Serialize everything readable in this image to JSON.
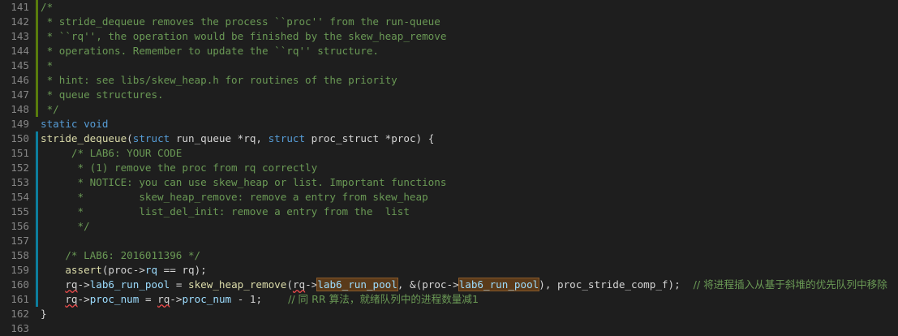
{
  "editor": {
    "lines": [
      {
        "num": "141",
        "bar": "green",
        "tokens": [
          {
            "t": "/*",
            "c": "comment"
          }
        ]
      },
      {
        "num": "142",
        "bar": "green",
        "tokens": [
          {
            "t": " * stride_dequeue removes the process ``proc'' from the run-queue",
            "c": "comment"
          }
        ]
      },
      {
        "num": "143",
        "bar": "green",
        "tokens": [
          {
            "t": " * ``rq'', the operation would be finished by the skew_heap_remove",
            "c": "comment"
          }
        ]
      },
      {
        "num": "144",
        "bar": "green",
        "tokens": [
          {
            "t": " * operations. Remember to update the ``rq'' structure.",
            "c": "comment"
          }
        ]
      },
      {
        "num": "145",
        "bar": "green",
        "tokens": [
          {
            "t": " *",
            "c": "comment"
          }
        ]
      },
      {
        "num": "146",
        "bar": "green",
        "tokens": [
          {
            "t": " * hint: see libs/skew_heap.h for routines of the priority",
            "c": "comment"
          }
        ]
      },
      {
        "num": "147",
        "bar": "green",
        "tokens": [
          {
            "t": " * queue structures.",
            "c": "comment"
          }
        ]
      },
      {
        "num": "148",
        "bar": "green",
        "tokens": [
          {
            "t": " */",
            "c": "comment"
          }
        ]
      },
      {
        "num": "149",
        "bar": "",
        "tokens": [
          {
            "t": "static void",
            "c": "keyword"
          }
        ]
      },
      {
        "num": "150",
        "bar": "blue",
        "tokens": [
          {
            "t": "stride_dequeue",
            "c": "fn"
          },
          {
            "t": "(",
            "c": "plain"
          },
          {
            "t": "struct",
            "c": "keyword"
          },
          {
            "t": " run_queue *rq, ",
            "c": "plain"
          },
          {
            "t": "struct",
            "c": "keyword"
          },
          {
            "t": " proc_struct *proc) {",
            "c": "plain"
          }
        ]
      },
      {
        "num": "151",
        "bar": "blue",
        "tokens": [
          {
            "t": "     /* LAB6: YOUR CODE",
            "c": "comment"
          }
        ]
      },
      {
        "num": "152",
        "bar": "blue",
        "tokens": [
          {
            "t": "      * (1) remove the proc from rq correctly",
            "c": "comment"
          }
        ]
      },
      {
        "num": "153",
        "bar": "blue",
        "tokens": [
          {
            "t": "      * NOTICE: you can use skew_heap or list. Important functions",
            "c": "comment"
          }
        ]
      },
      {
        "num": "154",
        "bar": "blue",
        "tokens": [
          {
            "t": "      *         skew_heap_remove: remove a entry from skew_heap",
            "c": "comment"
          }
        ]
      },
      {
        "num": "155",
        "bar": "blue",
        "tokens": [
          {
            "t": "      *         list_del_init: remove a entry from the  list",
            "c": "comment"
          }
        ]
      },
      {
        "num": "156",
        "bar": "blue",
        "tokens": [
          {
            "t": "      */",
            "c": "comment"
          }
        ]
      },
      {
        "num": "157",
        "bar": "blue",
        "tokens": []
      },
      {
        "num": "158",
        "bar": "blue",
        "tokens": [
          {
            "t": "    /* LAB6: 2016011396 */",
            "c": "comment"
          }
        ]
      },
      {
        "num": "159",
        "bar": "blue",
        "tokens": [
          {
            "t": "    ",
            "c": "plain"
          },
          {
            "t": "assert",
            "c": "fn"
          },
          {
            "t": "(proc->",
            "c": "plain"
          },
          {
            "t": "rq",
            "c": "var"
          },
          {
            "t": " == rq);",
            "c": "plain"
          }
        ]
      },
      {
        "num": "160",
        "bar": "blue",
        "tokens": [
          {
            "t": "    ",
            "c": "plain"
          },
          {
            "t": "rq",
            "c": "plain",
            "sq": true
          },
          {
            "t": "->",
            "c": "plain"
          },
          {
            "t": "lab6_run_pool",
            "c": "var"
          },
          {
            "t": " = ",
            "c": "plain"
          },
          {
            "t": "skew_heap_remove",
            "c": "fn"
          },
          {
            "t": "(",
            "c": "plain"
          },
          {
            "t": "rq",
            "c": "plain",
            "sq": true
          },
          {
            "t": "->",
            "c": "plain"
          },
          {
            "t": "lab6_run_pool",
            "c": "var",
            "hl": true
          },
          {
            "t": ", &(proc->",
            "c": "plain"
          },
          {
            "t": "lab6_run_pool",
            "c": "var",
            "hl": true
          },
          {
            "t": "), proc_stride_comp_f);",
            "c": "plain"
          },
          {
            "t": "    // 将进程插入从基于斜堆的优先队列中移除",
            "c": "cn"
          }
        ]
      },
      {
        "num": "161",
        "bar": "blue",
        "tokens": [
          {
            "t": "    ",
            "c": "plain"
          },
          {
            "t": "rq",
            "c": "plain",
            "sq": true
          },
          {
            "t": "->",
            "c": "plain"
          },
          {
            "t": "proc_num",
            "c": "var"
          },
          {
            "t": " = ",
            "c": "plain"
          },
          {
            "t": "rq",
            "c": "plain",
            "sq": true
          },
          {
            "t": "->",
            "c": "plain"
          },
          {
            "t": "proc_num",
            "c": "var"
          },
          {
            "t": " - 1;",
            "c": "plain"
          },
          {
            "t": "        // 同 RR 算法，就绪队列中的进程数量减1",
            "c": "cn"
          }
        ]
      },
      {
        "num": "162",
        "bar": "",
        "tokens": [
          {
            "t": "}",
            "c": "plain"
          }
        ]
      },
      {
        "num": "163",
        "bar": "",
        "tokens": []
      }
    ]
  }
}
